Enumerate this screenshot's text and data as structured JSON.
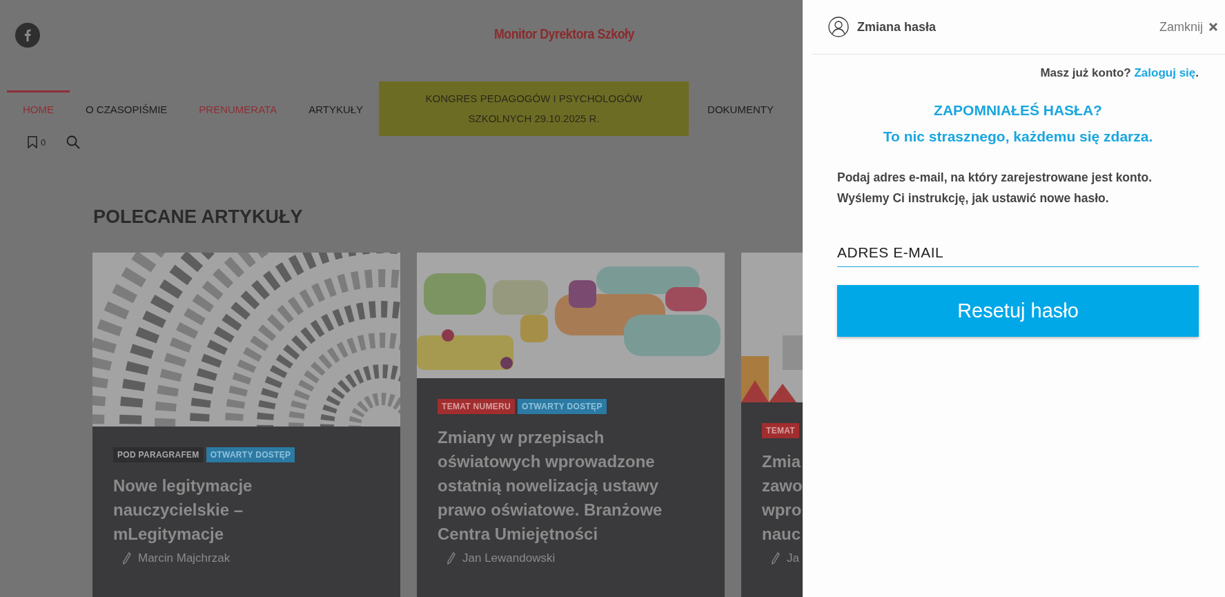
{
  "header": {
    "logo": "Monitor Dyrektora Szkoły"
  },
  "nav": {
    "items": [
      {
        "kind": "link",
        "label": "HOME",
        "selected": true,
        "color": "#8e2f36"
      },
      {
        "kind": "link",
        "label": "O CZASOPIŚMIE",
        "selected": false,
        "color": "#1c1c1c"
      },
      {
        "kind": "link",
        "label": "PRENUMERATA",
        "selected": false,
        "color": "#8e2f36"
      },
      {
        "kind": "link",
        "label": "ARTYKUŁY",
        "selected": false,
        "color": "#1c1c1c"
      },
      {
        "kind": "banner",
        "label": "KONGRES PEDAGOGÓW I PSYCHOLOGÓW SZKOLNYCH 29.10.2025 R.",
        "selected": false
      },
      {
        "kind": "link",
        "label": "DOKUMENTY",
        "selected": false,
        "color": "#1c1c1c"
      }
    ]
  },
  "bookmarks": {
    "count": "0"
  },
  "section_title": "POLECANE ARTYKUŁY",
  "cards": [
    {
      "tags": [
        {
          "label": "POD PARAGRAFEM",
          "kind": "section"
        },
        {
          "label": "OTWARTY DOSTĘP",
          "kind": "access"
        }
      ],
      "title_lines": [
        "Nowe legitymacje",
        "nauczycielskie –",
        "mLegitymacje"
      ],
      "author": "Marcin Majchrzak"
    },
    {
      "tags": [
        {
          "label": "TEMAT NUMERU",
          "kind": "topic"
        },
        {
          "label": "OTWARTY DOSTĘP",
          "kind": "access"
        }
      ],
      "title_lines": [
        "Zmiany w przepisach",
        "oświatowych wprowadzone",
        "ostatnią nowelizacją ustawy",
        "prawo oświatowe. Branżowe",
        "Centra Umiejętności"
      ],
      "author": "Jan Lewandowski"
    },
    {
      "tags": [
        {
          "label": "TEMAT",
          "kind": "topic"
        }
      ],
      "title_lines": [
        "Zmia",
        "zawo",
        "wpro",
        "nauc"
      ],
      "author": "Ja"
    }
  ],
  "panel": {
    "title": "Zmiana hasła",
    "close": "Zamknij",
    "login_prompt": {
      "text": "Masz już konto?",
      "link": "Zaloguj się",
      "after": "."
    },
    "headline": [
      "ZAPOMNIAŁEŚ HASŁA?",
      "To nic strasznego, każdemu się zdarza."
    ],
    "info_lines": [
      "Podaj adres e-mail, na który zarejestrowane jest konto.",
      "Wyślemy Ci instrukcję, jak ustawić nowe hasło."
    ],
    "email": {
      "placeholder": "ADRES E-MAIL"
    },
    "submit": "Resetuj hasło"
  }
}
